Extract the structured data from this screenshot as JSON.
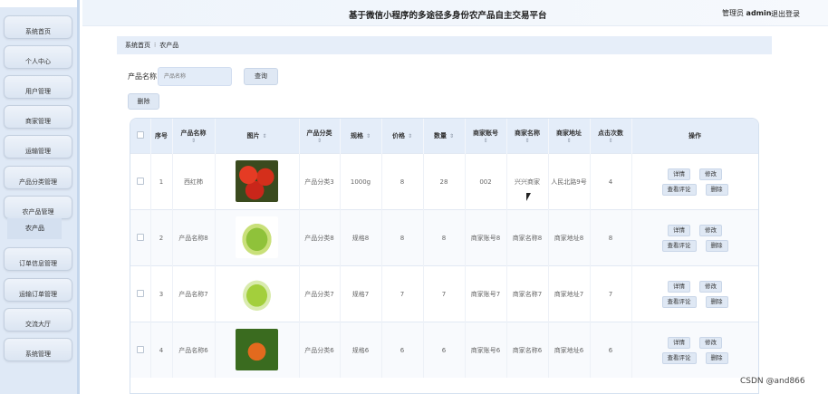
{
  "header": {
    "title": "基于微信小程序的多途径多身份农产品自主交易平台",
    "user_prefix": "管理员",
    "user_name": "admin",
    "logout": "退出登录"
  },
  "sidebar": {
    "items": [
      {
        "label": "系统首页"
      },
      {
        "label": "个人中心"
      },
      {
        "label": "用户管理"
      },
      {
        "label": "商家管理"
      },
      {
        "label": "运输管理"
      },
      {
        "label": "产品分类管理"
      },
      {
        "label": "农产品管理"
      },
      {
        "label": "订单信息管理"
      },
      {
        "label": "运输订单管理"
      },
      {
        "label": "交流大厅"
      },
      {
        "label": "系统管理"
      }
    ],
    "active_sub": "农产品"
  },
  "breadcrumb": {
    "home": "系统首页",
    "current": "农产品"
  },
  "search": {
    "label": "产品名称",
    "placeholder": "产品名称",
    "query_button": "查询",
    "delete_button": "删除"
  },
  "table": {
    "headers": {
      "index": "序号",
      "name": "产品名称",
      "image": "图片",
      "category": "产品分类",
      "spec": "规格",
      "price": "价格",
      "quantity": "数量",
      "merchant_account": "商家账号",
      "merchant_name": "商家名称",
      "merchant_address": "商家地址",
      "clicks": "点击次数",
      "actions": "操作"
    },
    "sort_glyph": "⇕",
    "rows": [
      {
        "index": "1",
        "name": "西红柿",
        "image": "tomato",
        "category": "产品分类3",
        "spec": "1000g",
        "price": "8",
        "quantity": "28",
        "merchant_account": "002",
        "merchant_name": "兴兴商家",
        "merchant_address": "人民北路9号",
        "clicks": "4"
      },
      {
        "index": "2",
        "name": "产品名称8",
        "image": "lettuce",
        "category": "产品分类8",
        "spec": "规格8",
        "price": "8",
        "quantity": "8",
        "merchant_account": "商家账号8",
        "merchant_name": "商家名称8",
        "merchant_address": "商家地址8",
        "clicks": "8"
      },
      {
        "index": "3",
        "name": "产品名称7",
        "image": "cabbage",
        "category": "产品分类7",
        "spec": "规格7",
        "price": "7",
        "quantity": "7",
        "merchant_account": "商家账号7",
        "merchant_name": "商家名称7",
        "merchant_address": "商家地址7",
        "clicks": "7"
      },
      {
        "index": "4",
        "name": "产品名称6",
        "image": "fruit",
        "category": "产品分类6",
        "spec": "规格6",
        "price": "6",
        "quantity": "6",
        "merchant_account": "商家账号6",
        "merchant_name": "商家名称6",
        "merchant_address": "商家地址6",
        "clicks": "6"
      }
    ],
    "row_actions": {
      "detail": "详情",
      "edit": "修改",
      "comments": "查看评论",
      "delete": "删除"
    }
  },
  "watermark": "CSDN @and866"
}
